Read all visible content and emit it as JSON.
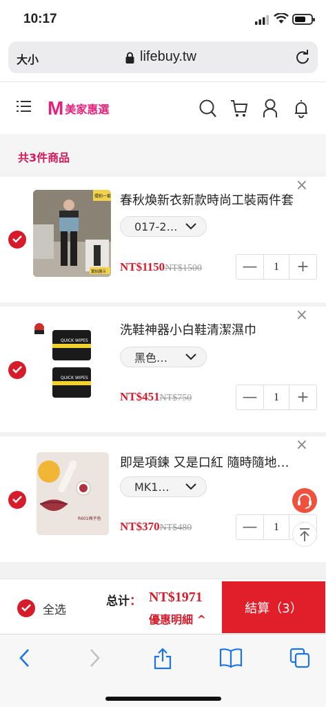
{
  "status_bar": {
    "time": "10:17",
    "battery_level": 0.7
  },
  "browser": {
    "text_size": "大小",
    "url": "lifebuy.tw"
  },
  "site": {
    "logo_mark": "M",
    "logo_text": "美家惠選"
  },
  "cart": {
    "count_label": "共3件商品",
    "items": [
      {
        "title": "春秋煥新衣新款時尚工裝兩件套",
        "variant": "017-2…",
        "price": "NT$1150",
        "original_price": "NT$1500",
        "quantity": "1",
        "badge": "擺拍一套",
        "badge2": "實拍展示"
      },
      {
        "title": "洗鞋神器小白鞋清潔濕巾",
        "variant": "黑色…",
        "price": "NT$451",
        "original_price": "NT$750",
        "quantity": "1",
        "pack_label": "QUICK WIPES"
      },
      {
        "title": "即是項鍊 又是口紅 隨時隨地…",
        "variant": "MK1…",
        "price": "NT$370",
        "original_price": "NT$480",
        "quantity": "1",
        "shade_label": "R601梅子色"
      }
    ],
    "remove_symbol": "×",
    "minus_symbol": "—",
    "plus_symbol": "+"
  },
  "checkout": {
    "select_all": "全选",
    "total_label": "总计",
    "total_colon": "：",
    "total_value": "NT$1971",
    "discount_detail": "優惠明細 ^",
    "button_label": "結算（3）"
  },
  "colors": {
    "brand": "#e6217b",
    "accent": "#e11f2a",
    "price": "#d61c2b"
  }
}
